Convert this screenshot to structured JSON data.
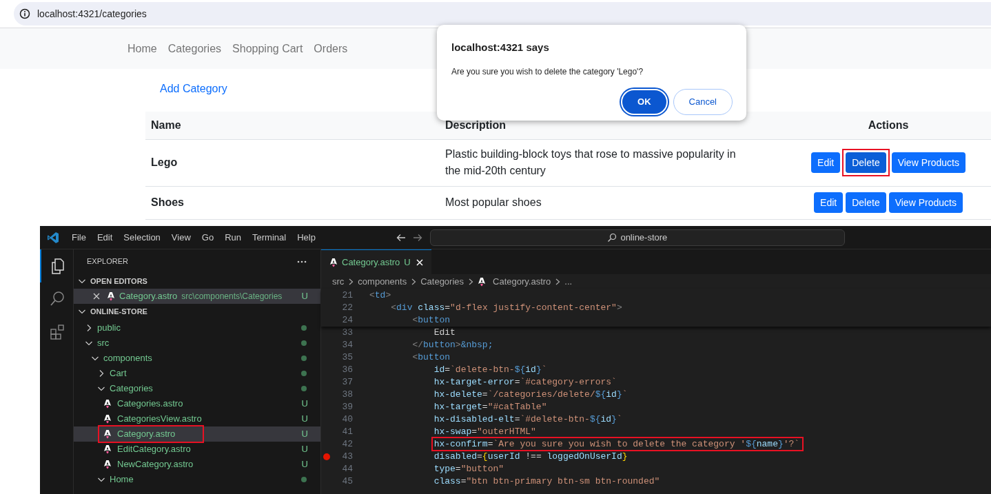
{
  "browser": {
    "url": "localhost:4321/categories"
  },
  "navbar": {
    "links": [
      "Home",
      "Categories",
      "Shopping Cart",
      "Orders"
    ]
  },
  "add_link": "Add Category",
  "table": {
    "columns": [
      "Name",
      "Description",
      "Actions"
    ],
    "rows": [
      {
        "name": "Lego",
        "description": "Plastic building-block toys that rose to massive popularity in the mid-20th century",
        "actions": [
          {
            "label": "Edit",
            "active": false,
            "highlighted": false
          },
          {
            "label": "Delete",
            "active": true,
            "highlighted": true
          },
          {
            "label": "View Products",
            "active": false,
            "highlighted": false
          }
        ]
      },
      {
        "name": "Shoes",
        "description": "Most popular shoes",
        "actions": [
          {
            "label": "Edit",
            "active": false,
            "highlighted": false
          },
          {
            "label": "Delete",
            "active": false,
            "highlighted": false
          },
          {
            "label": "View Products",
            "active": false,
            "highlighted": false
          }
        ]
      }
    ]
  },
  "dialog": {
    "title": "localhost:4321 says",
    "message": "Are you sure you wish to delete the category 'Lego'?",
    "buttons": [
      {
        "label": "OK",
        "kind": "primary"
      },
      {
        "label": "Cancel",
        "kind": "secondary"
      }
    ]
  },
  "vscode": {
    "menu": [
      "File",
      "Edit",
      "Selection",
      "View",
      "Go",
      "Run",
      "Terminal",
      "Help"
    ],
    "search": "online-store",
    "activity": [
      {
        "kind": "files",
        "selected": true
      },
      {
        "kind": "search",
        "selected": false
      },
      {
        "kind": "extensions",
        "selected": false
      }
    ],
    "explorer": {
      "title": "EXPLORER",
      "open_editors": {
        "title": "OPEN EDITORS",
        "expanded": true,
        "items": [
          {
            "name": "Category.astro",
            "path": "src\\components\\Categories",
            "status": "U",
            "selected": true
          }
        ]
      },
      "project": {
        "title": "ONLINE-STORE",
        "expanded": true,
        "tree": [
          {
            "name": "public",
            "kind": "folder",
            "expanded": false,
            "has_changes": true,
            "selected": false
          },
          {
            "name": "src",
            "kind": "folder",
            "expanded": true,
            "has_changes": true,
            "selected": false,
            "children": [
              {
                "name": "components",
                "kind": "folder",
                "expanded": true,
                "has_changes": true,
                "selected": false,
                "children": [
                  {
                    "name": "Cart",
                    "kind": "folder",
                    "expanded": false,
                    "has_changes": true,
                    "selected": false
                  },
                  {
                    "name": "Categories",
                    "kind": "folder",
                    "expanded": true,
                    "has_changes": true,
                    "selected": false,
                    "children": [
                      {
                        "name": "Categories.astro",
                        "kind": "file",
                        "status": "U",
                        "selected": false,
                        "highlighted": false
                      },
                      {
                        "name": "CategoriesView.astro",
                        "kind": "file",
                        "status": "U",
                        "selected": false,
                        "highlighted": false
                      },
                      {
                        "name": "Category.astro",
                        "kind": "file",
                        "status": "U",
                        "selected": true,
                        "highlighted": true
                      },
                      {
                        "name": "EditCategory.astro",
                        "kind": "file",
                        "status": "U",
                        "selected": false,
                        "highlighted": false
                      },
                      {
                        "name": "NewCategory.astro",
                        "kind": "file",
                        "status": "U",
                        "selected": false,
                        "highlighted": false
                      }
                    ]
                  },
                  {
                    "name": "Home",
                    "kind": "folder",
                    "expanded": true,
                    "has_changes": true,
                    "selected": false
                  }
                ]
              }
            ]
          }
        ]
      }
    },
    "tab": {
      "name": "Category.astro",
      "status": "U",
      "selected": true
    },
    "breadcrumbs": [
      {
        "text": "src",
        "kind": "folder"
      },
      {
        "text": "components",
        "kind": "folder"
      },
      {
        "text": "Categories",
        "kind": "folder"
      },
      {
        "text": "Category.astro",
        "kind": "file"
      },
      {
        "text": "...",
        "kind": "more"
      }
    ],
    "sticky_lines": [
      {
        "number": "21",
        "breakpoint": false,
        "highlighted": false,
        "code": "<td>"
      },
      {
        "number": "22",
        "breakpoint": false,
        "highlighted": false,
        "code": "    <div class=\"d-flex justify-content-center\">"
      },
      {
        "number": "24",
        "breakpoint": false,
        "highlighted": false,
        "code": "        <button"
      }
    ],
    "lines": [
      {
        "number": "33",
        "breakpoint": false,
        "highlighted": false,
        "code": "            Edit"
      },
      {
        "number": "34",
        "breakpoint": false,
        "highlighted": false,
        "code": "        </button>&nbsp;"
      },
      {
        "number": "35",
        "breakpoint": false,
        "highlighted": false,
        "code": "        <button"
      },
      {
        "number": "36",
        "breakpoint": false,
        "highlighted": false,
        "code": "            id=`delete-btn-${id}`"
      },
      {
        "number": "37",
        "breakpoint": false,
        "highlighted": false,
        "code": "            hx-target-error=`#category-errors`"
      },
      {
        "number": "38",
        "breakpoint": false,
        "highlighted": false,
        "code": "            hx-delete=`/categories/delete/${id}`"
      },
      {
        "number": "39",
        "breakpoint": false,
        "highlighted": false,
        "code": "            hx-target=\"#catTable\""
      },
      {
        "number": "40",
        "breakpoint": false,
        "highlighted": false,
        "code": "            hx-disabled-elt=`#delete-btn-${id}`"
      },
      {
        "number": "41",
        "breakpoint": false,
        "highlighted": false,
        "code": "            hx-swap=\"outerHTML\""
      },
      {
        "number": "42",
        "breakpoint": false,
        "highlighted": true,
        "code": "            hx-confirm=`Are you sure you wish to delete the category '${name}'?`"
      },
      {
        "number": "43",
        "breakpoint": true,
        "highlighted": false,
        "code": "            disabled={userId !== loggedOnUserId}"
      },
      {
        "number": "44",
        "breakpoint": false,
        "highlighted": false,
        "code": "            type=\"button\""
      },
      {
        "number": "45",
        "breakpoint": false,
        "highlighted": false,
        "code": "            class=\"btn btn-primary btn-sm btn-rounded\""
      }
    ]
  }
}
